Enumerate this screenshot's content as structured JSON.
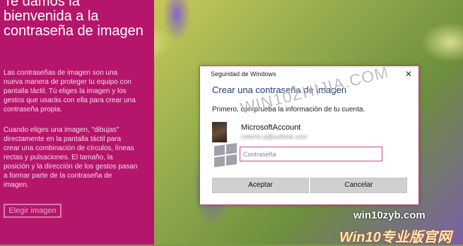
{
  "left_panel": {
    "title": "Te damos la bienvenida a la contraseña de imagen",
    "paragraph1": "Las contraseñas de imagen son una nueva manera de proteger tu equipo con pantalla táctil. Tú eliges la imagen y los gestos que usarás con ella para crear una contraseña propia.",
    "paragraph2": "Cuando eliges una imagen, \"dibujas\" directamente en la pantalla táctil para crear una combinación de círculos, líneas rectas y pulsaciones. El tamaño, la posición y la dirección de los gestos pasan a formar parte de la contraseña de imagen.",
    "choose_button": "Elegir imagen"
  },
  "dialog": {
    "window_title": "Seguridad de Windows",
    "close_glyph": "✕",
    "heading": "Crear una contraseña de imagen",
    "instruction": "Primero, comprueba la información de tu cuenta.",
    "account_name": "MicrosoftAccount",
    "account_email": "roberto.a@outlook.com",
    "password_placeholder": "Contraseña",
    "accept_label": "Aceptar",
    "cancel_label": "Cancelar"
  },
  "watermark": {
    "site_text": "WIN10ZHIJIA.COM",
    "url": "win10zyb.com",
    "brand": "Win10专业版官网"
  },
  "colors": {
    "panel": "#b5166b",
    "dialog_border": "#c04a85",
    "heading": "#1e3a78"
  }
}
